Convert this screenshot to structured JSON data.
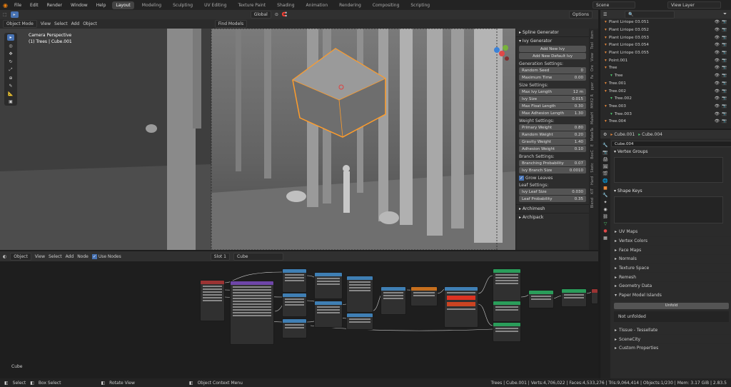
{
  "menu": {
    "items": [
      "File",
      "Edit",
      "Render",
      "Window",
      "Help"
    ]
  },
  "workspaces": [
    "Layout",
    "Modeling",
    "Sculpting",
    "UV Editing",
    "Texture Paint",
    "Shading",
    "Animation",
    "Rendering",
    "Compositing",
    "Scripting"
  ],
  "scene": {
    "label": "Scene",
    "view_layer": "View Layer"
  },
  "viewport": {
    "mode": "Object Mode",
    "menus": [
      "View",
      "Select",
      "Add",
      "Object"
    ],
    "transform": "Global",
    "find": "Find Models",
    "options": "Options",
    "info_line1": "Camera Perspective",
    "info_line2": "(1) Trees | Cube.001"
  },
  "ivy": {
    "spline_generator": "Spline Generator",
    "ivy_generator": "Ivy Generator",
    "add_new": "Add New Ivy",
    "add_default": "Add New Default Ivy",
    "gen_settings": "Generation Settings:",
    "random_seed": {
      "label": "Random Seed",
      "value": "0"
    },
    "max_time": {
      "label": "Maximum Time",
      "value": "0.00"
    },
    "size_settings": "Size Settings:",
    "max_ivy_length": {
      "label": "Max Ivy Length",
      "value": "12 m"
    },
    "ivy_size": {
      "label": "Ivy Size",
      "value": "0.015"
    },
    "max_float": {
      "label": "Max Float Length",
      "value": "0.30"
    },
    "max_adhesion": {
      "label": "Max Adhesion Length",
      "value": "1.30"
    },
    "weight_settings": "Weight Settings:",
    "primary_weight": {
      "label": "Primary Weight",
      "value": "0.80"
    },
    "random_weight": {
      "label": "Random Weight",
      "value": "0.20"
    },
    "gravity_weight": {
      "label": "Gravity Weight",
      "value": "1.40"
    },
    "adhesion_weight": {
      "label": "Adhesion Weight",
      "value": "0.10"
    },
    "branch_settings": "Branch Settings:",
    "branching_prob": {
      "label": "Branching Probability",
      "value": "0.07"
    },
    "branch_size": {
      "label": "Ivy Branch Size",
      "value": "0.0010"
    },
    "grow_leaves": "Grow Leaves",
    "leaf_settings": "Leaf Settings:",
    "leaf_size": {
      "label": "Ivy Leaf Size",
      "value": "0.030"
    },
    "leaf_prob": {
      "label": "Leaf Probability",
      "value": "0.35"
    },
    "archimesh": "Archimesh",
    "archipack": "Archipack"
  },
  "vtabs": [
    "Item",
    "Tool",
    "View",
    "Ore",
    "Fa",
    "pper",
    "MHX2 R",
    "MakeH",
    "MakeTa",
    "E",
    "BoxC",
    "Sketc",
    "Hard",
    "KIT",
    "Blend"
  ],
  "node_editor": {
    "mode": "Object",
    "menus": [
      "View",
      "Select",
      "Add",
      "Node"
    ],
    "use_nodes": "Use Nodes",
    "slot": "Slot 1",
    "material": "Cube",
    "label": "Cube"
  },
  "outliner": {
    "items": [
      {
        "name": "Plant Liriope 03.051",
        "color": "#e8883a"
      },
      {
        "name": "Plant Liriope 03.052",
        "color": "#e8883a"
      },
      {
        "name": "Plant Liriope 03.053",
        "color": "#e8883a"
      },
      {
        "name": "Plant Liriope 03.054",
        "color": "#e8883a"
      },
      {
        "name": "Plant Liriope 03.055",
        "color": "#e8883a"
      },
      {
        "name": "Point.001",
        "color": "#e8883a"
      },
      {
        "name": "Tree",
        "color": "#e8883a"
      },
      {
        "name": "Tree",
        "color": "#4fc66f"
      },
      {
        "name": "Tree.001",
        "color": "#e8883a"
      },
      {
        "name": "Tree.002",
        "color": "#e8883a"
      },
      {
        "name": "Tree.002",
        "color": "#4fc66f"
      },
      {
        "name": "Tree.003",
        "color": "#e8883a"
      },
      {
        "name": "Tree.003",
        "color": "#4fc66f"
      },
      {
        "name": "Tree.004",
        "color": "#e8883a"
      }
    ]
  },
  "properties": {
    "object": "Cube.001",
    "data": "Cube.004",
    "mesh_name": "Cube.004",
    "vertex_groups": "Vertex Groups",
    "shape_keys": "Shape Keys",
    "sections": [
      "UV Maps",
      "Vertex Colors",
      "Face Maps",
      "Normals",
      "Texture Space",
      "Remesh",
      "Geometry Data",
      "Paper Model Islands"
    ],
    "unfold": "Unfold",
    "not_unfolded": "Not unfolded",
    "tissue": "Tissue - Tessellate",
    "scenecity": "SceneCity",
    "custom_props": "Custom Properties"
  },
  "status": {
    "select": "Select",
    "box_select": "Box Select",
    "rotate": "Rotate View",
    "context": "Object Context Menu",
    "stats": "Trees | Cube.001 | Verts:4,706,022 | Faces:4,533,276 | Tris:9,064,414 | Objects:1/230 | Mem: 3.17 GiB | 2.83.5"
  }
}
